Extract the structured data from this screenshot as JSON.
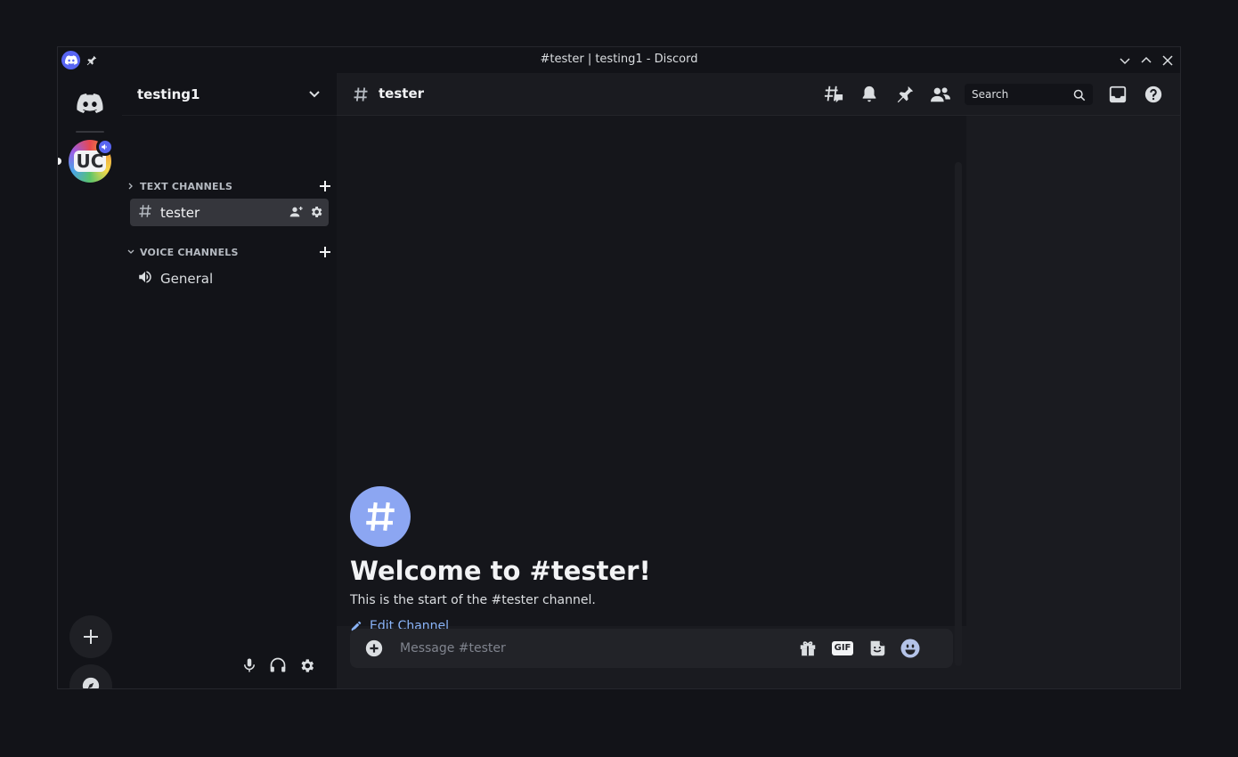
{
  "window": {
    "title": "#tester | testing1 - Discord"
  },
  "icons": {
    "app": "discord-logo-icon",
    "pin": "pin-icon",
    "minimize": "chevron-down-icon",
    "maximize": "chevron-up-icon",
    "close": "close-icon"
  },
  "server_rail": {
    "home": "discord-home-icon",
    "servers": [
      {
        "name": "testing1",
        "initials": "UC",
        "has_voice_activity": true,
        "selected": true
      }
    ],
    "add_server": "plus-icon",
    "explore": "compass-icon"
  },
  "sidebar": {
    "server_name": "testing1",
    "categories": [
      {
        "label": "TEXT CHANNELS",
        "collapsed": true,
        "channels": [
          {
            "name": "tester",
            "type": "text",
            "active": true
          }
        ]
      },
      {
        "label": "VOICE CHANNELS",
        "collapsed": false,
        "channels": [
          {
            "name": "General",
            "type": "voice",
            "active": false
          }
        ]
      }
    ],
    "user_controls": [
      "microphone-icon",
      "headphones-icon",
      "settings-gear-icon"
    ]
  },
  "header": {
    "channel_name": "tester",
    "tools": [
      "threads-icon",
      "notification-bell-icon",
      "pinned-messages-icon",
      "member-list-icon"
    ],
    "search_placeholder": "Search",
    "inbox": "inbox-icon",
    "help": "help-icon"
  },
  "welcome": {
    "title": "Welcome to #tester!",
    "subtitle": "This is the start of the #tester channel.",
    "edit_label": "Edit Channel"
  },
  "composer": {
    "placeholder": "Message #tester",
    "gif_label": "GIF",
    "tools": [
      "gift-icon",
      "gif-icon",
      "sticker-icon",
      "emoji-icon"
    ]
  },
  "colors": {
    "accent": "#5865f2",
    "link": "#8ab4f8",
    "welcome_avatar": "#8ca6f2"
  }
}
